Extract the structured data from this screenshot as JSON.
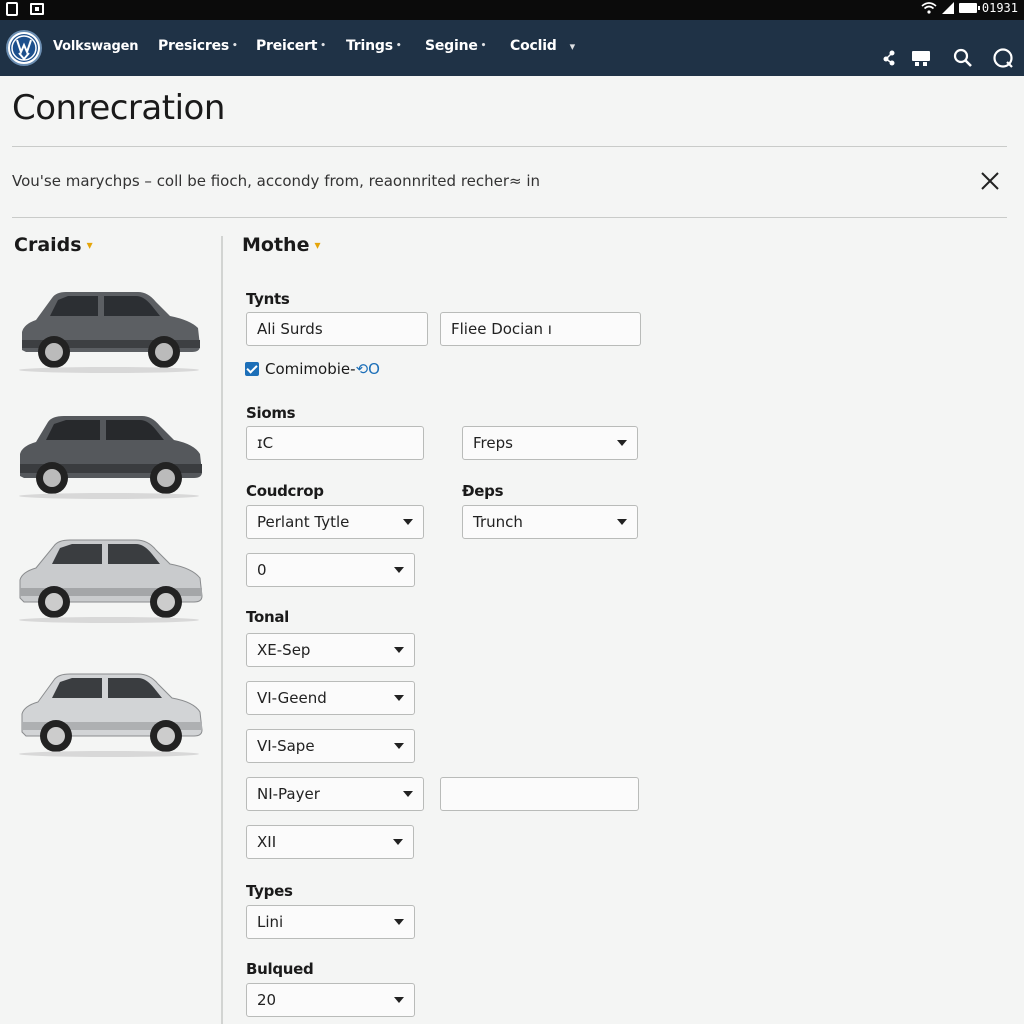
{
  "status_bar": {
    "time": "01931"
  },
  "nav": {
    "brand": "Volkswagen",
    "items": [
      {
        "label": "Presicres"
      },
      {
        "label": "Preicert"
      },
      {
        "label": "Trings"
      },
      {
        "label": "Segine"
      },
      {
        "label": "Coclid"
      }
    ],
    "icons": [
      "network-icon",
      "device-icon",
      "search-icon",
      "help-icon"
    ]
  },
  "header": {
    "title": "Conrecration",
    "notice": "Vou'se marychps – coll be fioch, accondy from, reaonnrited recher≈ in"
  },
  "left_panel": {
    "heading": "Craids",
    "cars": [
      {
        "name": "car-dark-grey-1",
        "color": "#5c5f63"
      },
      {
        "name": "car-dark-grey-2",
        "color": "#55585c"
      },
      {
        "name": "car-silver-1",
        "color": "#c9cbcd"
      },
      {
        "name": "car-silver-2",
        "color": "#d2d4d6"
      }
    ]
  },
  "form": {
    "heading": "Mothe",
    "tynts": {
      "label": "Tynts",
      "field1": "Ali Surds",
      "field2": "Fliee Docian ı"
    },
    "checkbox": {
      "label": "Comimobie-",
      "suffix": "⟲O",
      "checked": true
    },
    "sioms": {
      "label": "Sioms",
      "field": "ɪC",
      "select": "Freps"
    },
    "coudcrop": {
      "label": "Coudcrop",
      "select1": "Perlant Tytle",
      "select2": "0"
    },
    "deps": {
      "label": "Ðeps",
      "select": "Trunch"
    },
    "tonal": {
      "label": "Tonal",
      "selects": [
        "XE-Sep",
        "VI-Geend",
        "VI-Sape",
        "NI-Payer",
        "XII"
      ],
      "extra_field": ""
    },
    "types": {
      "label": "Types",
      "select": "Lini"
    },
    "bulqued": {
      "label": "Bulqued",
      "select": "20"
    }
  }
}
